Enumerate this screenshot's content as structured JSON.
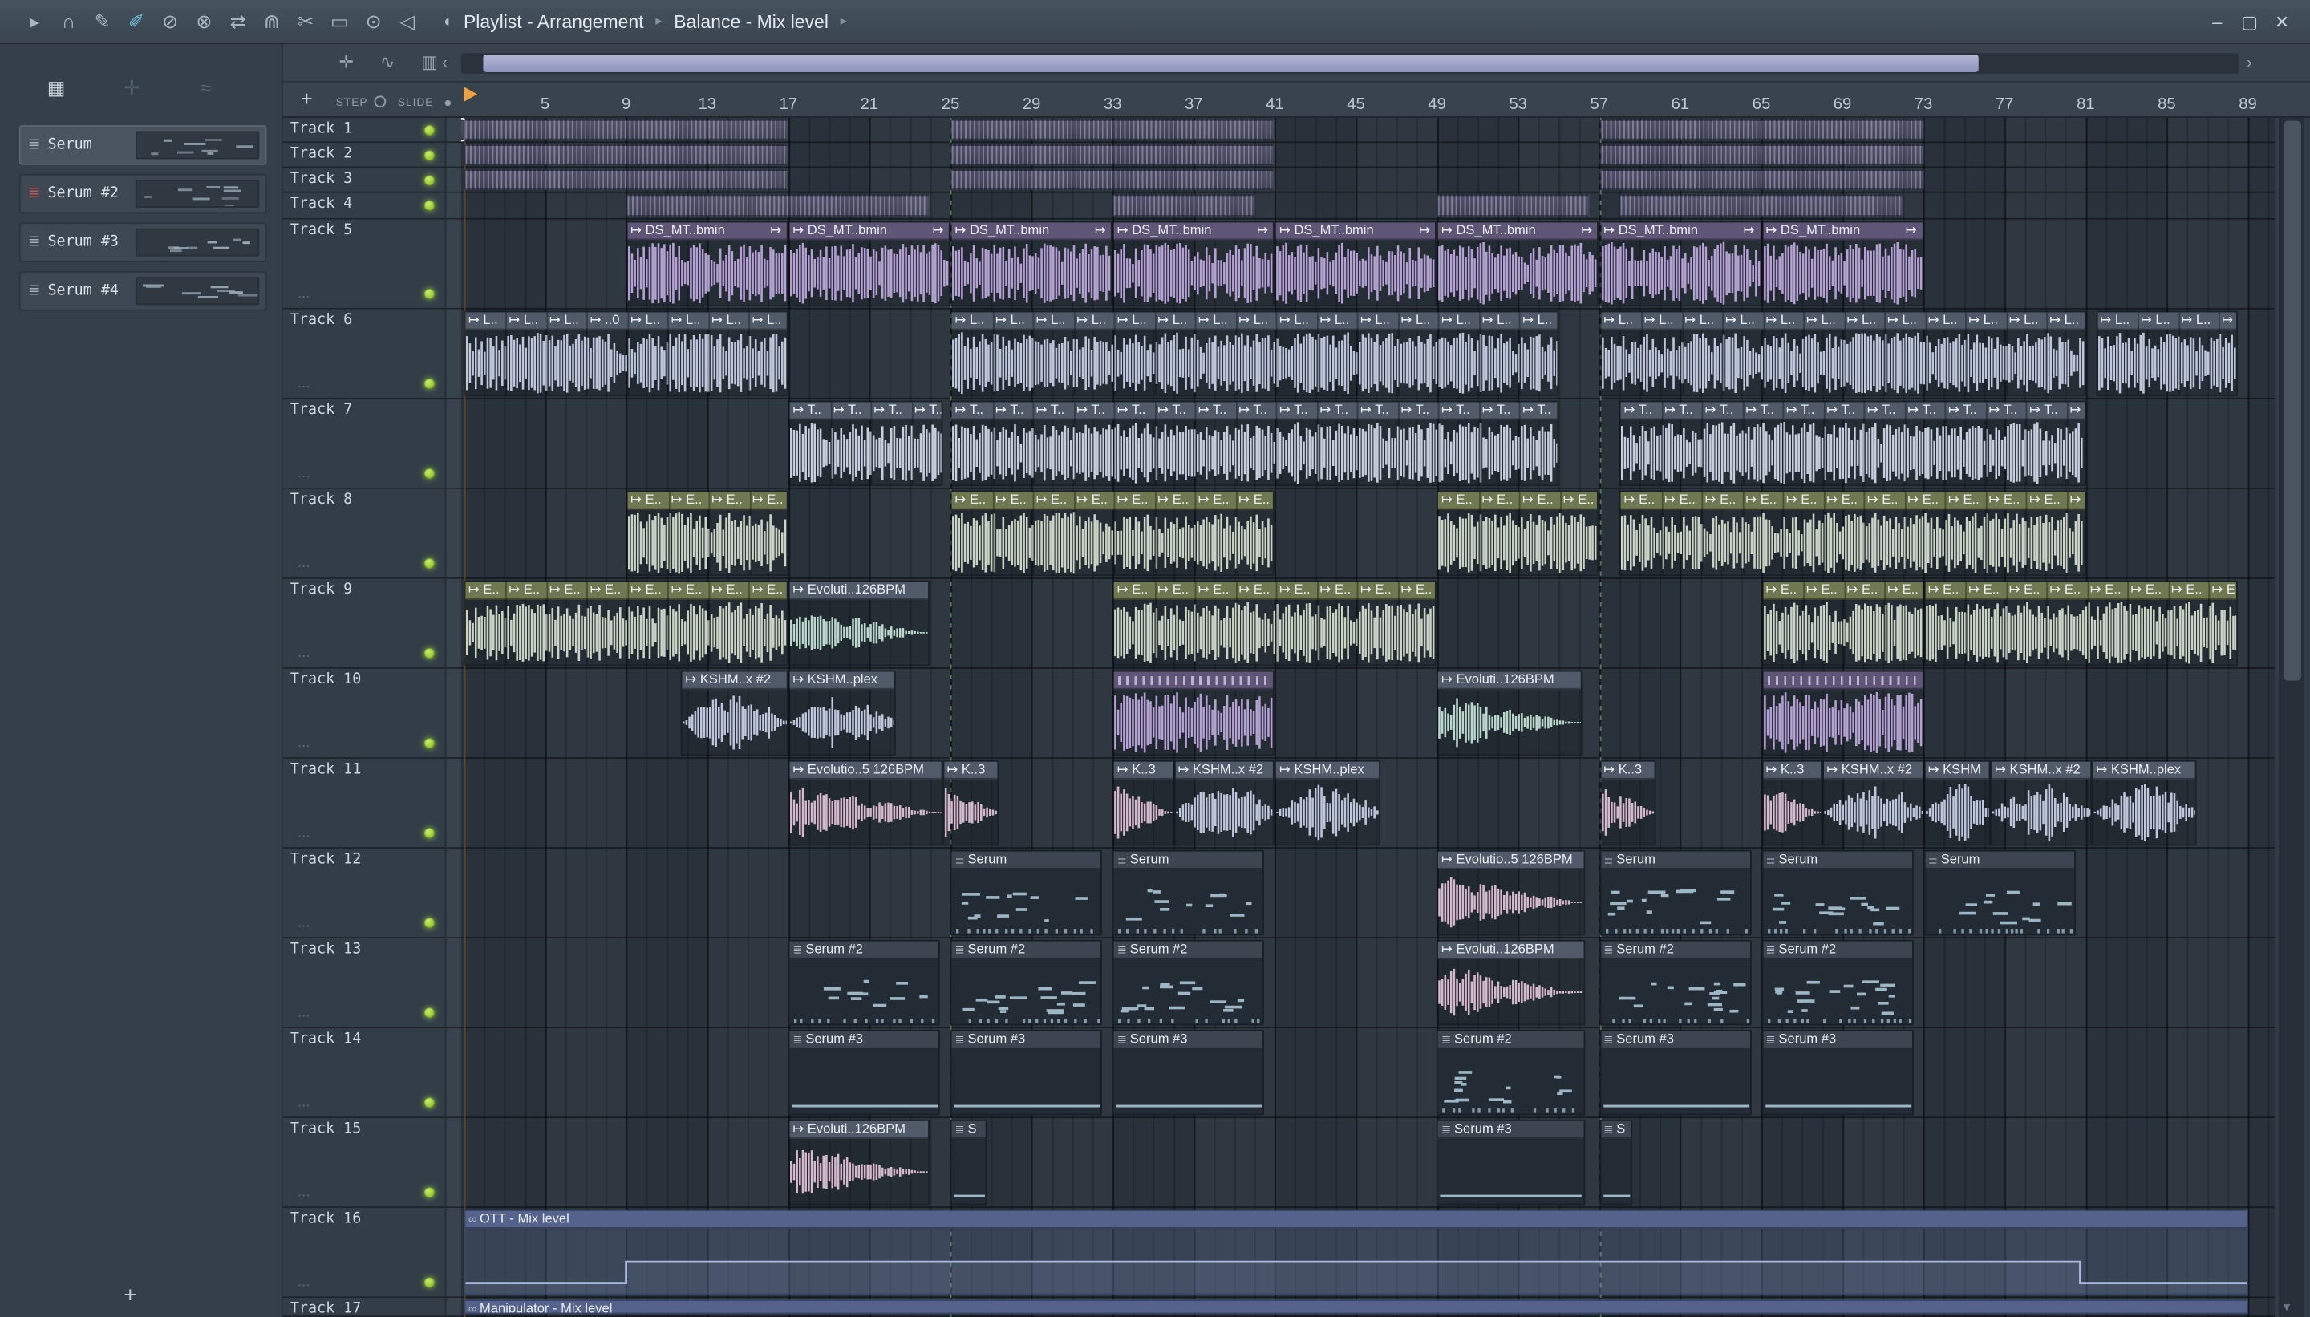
{
  "titlebar": {
    "icons": [
      {
        "name": "menu-arrow-icon",
        "glyph": "▸"
      },
      {
        "name": "headphones-icon",
        "glyph": "∩"
      },
      {
        "name": "draw-tool-icon",
        "glyph": "✎"
      },
      {
        "name": "paint-tool-icon",
        "glyph": "✐",
        "active": true
      },
      {
        "name": "delete-tool-icon",
        "glyph": "⊘"
      },
      {
        "name": "mute-tool-icon",
        "glyph": "⊗"
      },
      {
        "name": "slip-tool-icon",
        "glyph": "⇄"
      },
      {
        "name": "magnet-icon",
        "glyph": "⋒"
      },
      {
        "name": "slice-tool-icon",
        "glyph": "✂"
      },
      {
        "name": "select-tool-icon",
        "glyph": "▭"
      },
      {
        "name": "zoom-tool-icon",
        "glyph": "⊙"
      },
      {
        "name": "preview-tool-icon",
        "glyph": "◁"
      }
    ],
    "panel_icon": "◖",
    "breadcrumb": [
      "Playlist - Arrangement",
      "Balance - Mix level"
    ],
    "separator": "▸",
    "window_controls": {
      "minimize": "–",
      "maximize": "▢",
      "close": "✕"
    }
  },
  "sidebar": {
    "toolbar_icons": [
      {
        "name": "piano-roll-icon",
        "glyph": "▦",
        "dim": false
      },
      {
        "name": "pattern-dim-icon",
        "glyph": "✛",
        "dim": true
      },
      {
        "name": "wave-dim-icon",
        "glyph": "≈",
        "dim": true
      }
    ],
    "patterns": [
      {
        "name": "Serum",
        "selected": true,
        "icon_color": "#9fb0bc"
      },
      {
        "name": "Serum #2",
        "selected": false,
        "icon_color": "#c85050"
      },
      {
        "name": "Serum #3",
        "selected": false,
        "icon_color": "#9fb0bc"
      },
      {
        "name": "Serum #4",
        "selected": false,
        "icon_color": "#9fb0bc"
      }
    ],
    "add_button": "+"
  },
  "playlist": {
    "toolbar_icons": [
      {
        "name": "pointer-tool-icon",
        "glyph": "✛"
      },
      {
        "name": "link-tool-icon",
        "glyph": "∿"
      },
      {
        "name": "view-options-icon",
        "glyph": "▥"
      }
    ],
    "scroll": {
      "left_arrow": "‹",
      "right_arrow": "›",
      "down_arrow": "▾"
    },
    "add_track_button": "+",
    "step_label": "STEP",
    "slide_label": "SLIDE",
    "timeline_numbers": [
      5,
      9,
      13,
      17,
      21,
      25,
      29,
      33,
      37,
      41,
      45,
      49,
      53,
      57,
      61,
      65,
      69,
      73,
      77,
      81,
      85,
      89
    ],
    "marker_bars": [
      25,
      57
    ],
    "tracks": [
      "Track 1",
      "Track 2",
      "Track 3",
      "Track 4",
      "Track 5",
      "Track 6",
      "Track 7",
      "Track 8",
      "Track 9",
      "Track 10",
      "Track 11",
      "Track 12",
      "Track 13",
      "Track 14",
      "Track 15",
      "Track 16",
      "Track 17"
    ],
    "clips": [
      {
        "t": 1,
        "b0": 0.22,
        "b1": 1,
        "k": "stripes",
        "sel": true
      },
      {
        "t": 1,
        "b0": 1,
        "b1": 17,
        "k": "stripes"
      },
      {
        "t": 1,
        "b0": 25,
        "b1": 41,
        "k": "stripes"
      },
      {
        "t": 1,
        "b0": 57,
        "b1": 73,
        "k": "stripes"
      },
      {
        "t": 2,
        "b0": 1,
        "b1": 17,
        "k": "stripes"
      },
      {
        "t": 2,
        "b0": 25,
        "b1": 41,
        "k": "stripes"
      },
      {
        "t": 2,
        "b0": 57,
        "b1": 73,
        "k": "stripes"
      },
      {
        "t": 3,
        "b0": 1,
        "b1": 17,
        "k": "stripes"
      },
      {
        "t": 3,
        "b0": 25,
        "b1": 41,
        "k": "stripes"
      },
      {
        "t": 3,
        "b0": 57,
        "b1": 73,
        "k": "stripes"
      },
      {
        "t": 4,
        "b0": 9,
        "b1": 24,
        "k": "stripes"
      },
      {
        "t": 4,
        "b0": 33,
        "b1": 40,
        "k": "stripes"
      },
      {
        "t": 4,
        "b0": 49,
        "b1": 56.5,
        "k": "stripes"
      },
      {
        "t": 4,
        "b0": 58,
        "b1": 72,
        "k": "stripes"
      },
      {
        "t": 5,
        "b0": 9,
        "b1": 17,
        "k": "wave",
        "pal": "purple",
        "env": "flat",
        "labels": [
          {
            "o": 0,
            "x": "↦ DS_MT..bmin"
          },
          {
            "o": 6.9,
            "x": "↦"
          }
        ]
      },
      {
        "t": 5,
        "b0": 17,
        "b1": 25,
        "k": "wave",
        "pal": "purple",
        "env": "flat",
        "labels": [
          {
            "o": 0,
            "x": "↦ DS_MT..bmin"
          },
          {
            "o": 6.9,
            "x": "↦"
          }
        ]
      },
      {
        "t": 5,
        "b0": 25,
        "b1": 33,
        "k": "wave",
        "pal": "purple",
        "env": "flat",
        "labels": [
          {
            "o": 0,
            "x": "↦ DS_MT..bmin"
          },
          {
            "o": 6.9,
            "x": "↦"
          }
        ]
      },
      {
        "t": 5,
        "b0": 33,
        "b1": 41,
        "k": "wave",
        "pal": "purple",
        "env": "flat",
        "labels": [
          {
            "o": 0,
            "x": "↦ DS_MT..bmin"
          },
          {
            "o": 6.9,
            "x": "↦"
          }
        ]
      },
      {
        "t": 5,
        "b0": 41,
        "b1": 49,
        "k": "wave",
        "pal": "purple",
        "env": "flat",
        "labels": [
          {
            "o": 0,
            "x": "↦ DS_MT..bmin"
          },
          {
            "o": 6.9,
            "x": "↦"
          }
        ]
      },
      {
        "t": 5,
        "b0": 49,
        "b1": 57,
        "k": "wave",
        "pal": "purple",
        "env": "flat",
        "labels": [
          {
            "o": 0,
            "x": "↦ DS_MT..bmin"
          },
          {
            "o": 6.9,
            "x": "↦"
          }
        ]
      },
      {
        "t": 5,
        "b0": 57,
        "b1": 65,
        "k": "wave",
        "pal": "purple",
        "env": "flat",
        "labels": [
          {
            "o": 0,
            "x": "↦ DS_MT..bmin"
          },
          {
            "o": 6.9,
            "x": "↦"
          }
        ]
      },
      {
        "t": 5,
        "b0": 65,
        "b1": 73,
        "k": "wave",
        "pal": "purple",
        "env": "flat",
        "labels": [
          {
            "o": 0,
            "x": "↦ DS_MT..bmin"
          },
          {
            "o": 6.9,
            "x": "↦"
          }
        ]
      },
      {
        "t": 6,
        "b0": 1,
        "b1": 17,
        "k": "wave",
        "pal": "lav",
        "env": "flat",
        "reps": {
          "every": 2,
          "texts": [
            "↦ L..",
            "↦ L..",
            "↦ L..",
            "↦ ..0",
            "↦ L..",
            "↦ L..",
            "↦ L..",
            "↦ L.."
          ]
        }
      },
      {
        "t": 6,
        "b0": 25,
        "b1": 55,
        "k": "wave",
        "pal": "lav",
        "env": "flat",
        "rep": {
          "every": 2,
          "x": "↦ L.."
        }
      },
      {
        "t": 6,
        "b0": 57,
        "b1": 81,
        "k": "wave",
        "pal": "lav",
        "env": "flat",
        "rep": {
          "every": 2,
          "x": "↦ L.."
        }
      },
      {
        "t": 6,
        "b0": 81.5,
        "b1": 88.5,
        "k": "wave",
        "pal": "lav",
        "env": "flat",
        "rep": {
          "every": 2,
          "x": "↦ L.."
        }
      },
      {
        "t": 7,
        "b0": 17,
        "b1": 24.6,
        "k": "wave",
        "pal": "pale",
        "env": "flat",
        "rep": {
          "every": 2,
          "x": "↦ T.."
        }
      },
      {
        "t": 7,
        "b0": 25,
        "b1": 55,
        "k": "wave",
        "pal": "pale",
        "env": "flat",
        "rep": {
          "every": 2,
          "x": "↦ T.."
        }
      },
      {
        "t": 7,
        "b0": 58,
        "b1": 81,
        "k": "wave",
        "pal": "pale",
        "env": "flat",
        "rep": {
          "every": 2,
          "x": "↦ T.."
        }
      },
      {
        "t": 8,
        "b0": 9,
        "b1": 17,
        "k": "wave",
        "pal": "olive",
        "env": "flat",
        "rep": {
          "every": 2,
          "x": "↦ E.."
        }
      },
      {
        "t": 8,
        "b0": 25,
        "b1": 41,
        "k": "wave",
        "pal": "olive",
        "env": "flat",
        "rep": {
          "every": 2,
          "x": "↦ E.."
        }
      },
      {
        "t": 8,
        "b0": 49,
        "b1": 57,
        "k": "wave",
        "pal": "olive",
        "env": "flat",
        "rep": {
          "every": 2,
          "x": "↦ E.."
        }
      },
      {
        "t": 8,
        "b0": 58,
        "b1": 81,
        "k": "wave",
        "pal": "olive",
        "env": "flat",
        "rep": {
          "every": 2,
          "x": "↦ E.."
        }
      },
      {
        "t": 9,
        "b0": 1,
        "b1": 17,
        "k": "wave",
        "pal": "olive",
        "env": "flat",
        "rep": {
          "every": 2,
          "x": "↦ E.."
        }
      },
      {
        "t": 9,
        "b0": 17,
        "b1": 24,
        "k": "wave",
        "pal": "mint",
        "env": "decay",
        "label": "↦ Evoluti..126BPM"
      },
      {
        "t": 9,
        "b0": 33,
        "b1": 49,
        "k": "wave",
        "pal": "olive",
        "env": "flat",
        "rep": {
          "every": 2,
          "x": "↦ E.."
        }
      },
      {
        "t": 9,
        "b0": 65,
        "b1": 73,
        "k": "wave",
        "pal": "olive",
        "env": "flat",
        "rep": {
          "every": 2,
          "x": "↦ E.."
        }
      },
      {
        "t": 9,
        "b0": 73,
        "b1": 88.5,
        "k": "wave",
        "pal": "olive",
        "env": "flat",
        "rep": {
          "every": 2,
          "x": "↦ E.."
        }
      },
      {
        "t": 10,
        "b0": 11.7,
        "b1": 17,
        "k": "wave",
        "pal": "lav",
        "env": "swell",
        "label": "↦ KSHM..x #2"
      },
      {
        "t": 10,
        "b0": 17,
        "b1": 22.3,
        "k": "wave",
        "pal": "lav",
        "env": "swell",
        "label": "↦ KSHM..plex"
      },
      {
        "t": 10,
        "b0": 33,
        "b1": 41,
        "k": "wave",
        "pal": "purple",
        "env": "flat",
        "ticks": true
      },
      {
        "t": 10,
        "b0": 49,
        "b1": 56.2,
        "k": "wave",
        "pal": "mint",
        "env": "decay",
        "label": "↦ Evoluti..126BPM"
      },
      {
        "t": 10,
        "b0": 65,
        "b1": 73,
        "k": "wave",
        "pal": "purple",
        "env": "flat",
        "ticks": true
      },
      {
        "t": 11,
        "b0": 17,
        "b1": 24.6,
        "k": "wave",
        "pal": "pink",
        "env": "decay",
        "label": "↦ Evolutio..5 126BPM"
      },
      {
        "t": 11,
        "b0": 24.6,
        "b1": 27.4,
        "k": "wave",
        "pal": "pink",
        "env": "decay",
        "label": "↦ K..3"
      },
      {
        "t": 11,
        "b0": 33,
        "b1": 36,
        "k": "wave",
        "pal": "pink",
        "env": "decay",
        "label": "↦ K..3"
      },
      {
        "t": 11,
        "b0": 36,
        "b1": 41,
        "k": "wave",
        "pal": "lav",
        "env": "swell",
        "label": "↦ KSHM..x #2"
      },
      {
        "t": 11,
        "b0": 41,
        "b1": 46.2,
        "k": "wave",
        "pal": "lav",
        "env": "swell",
        "label": "↦ KSHM..plex"
      },
      {
        "t": 11,
        "b0": 57,
        "b1": 59.8,
        "k": "wave",
        "pal": "pink",
        "env": "decay",
        "label": "↦ K..3"
      },
      {
        "t": 11,
        "b0": 65,
        "b1": 68,
        "k": "wave",
        "pal": "pink",
        "env": "decay",
        "label": "↦ K..3"
      },
      {
        "t": 11,
        "b0": 68,
        "b1": 73,
        "k": "wave",
        "pal": "lav",
        "env": "swell",
        "label": "↦ KSHM..x #2"
      },
      {
        "t": 11,
        "b0": 73,
        "b1": 76.3,
        "k": "wave",
        "pal": "lav",
        "env": "swell",
        "label": "↦ KSHM"
      },
      {
        "t": 11,
        "b0": 76.3,
        "b1": 81.3,
        "k": "wave",
        "pal": "lav",
        "env": "swell",
        "label": "↦ KSHM..x #2"
      },
      {
        "t": 11,
        "b0": 81.3,
        "b1": 86.5,
        "k": "wave",
        "pal": "lav",
        "env": "swell",
        "label": "↦ KSHM..plex"
      },
      {
        "t": 12,
        "b0": 25,
        "b1": 32.5,
        "k": "midi",
        "label": "Serum"
      },
      {
        "t": 12,
        "b0": 33,
        "b1": 40.5,
        "k": "midi",
        "label": "Serum"
      },
      {
        "t": 12,
        "b0": 49,
        "b1": 56.3,
        "k": "wave",
        "pal": "pink",
        "env": "decay",
        "label": "↦ Evolutio..5 126BPM"
      },
      {
        "t": 12,
        "b0": 57,
        "b1": 64.5,
        "k": "midi",
        "label": "Serum"
      },
      {
        "t": 12,
        "b0": 65,
        "b1": 72.5,
        "k": "midi",
        "label": "Serum"
      },
      {
        "t": 12,
        "b0": 73,
        "b1": 80.5,
        "k": "midi",
        "label": "Serum"
      },
      {
        "t": 13,
        "b0": 17,
        "b1": 24.5,
        "k": "midi",
        "label": "Serum #2"
      },
      {
        "t": 13,
        "b0": 25,
        "b1": 32.5,
        "k": "midi",
        "label": "Serum #2"
      },
      {
        "t": 13,
        "b0": 33,
        "b1": 40.5,
        "k": "midi",
        "label": "Serum #2"
      },
      {
        "t": 13,
        "b0": 49,
        "b1": 56.3,
        "k": "wave",
        "pal": "pink",
        "env": "decay",
        "label": "↦ Evoluti..126BPM"
      },
      {
        "t": 13,
        "b0": 57,
        "b1": 64.5,
        "k": "midi",
        "label": "Serum #2"
      },
      {
        "t": 13,
        "b0": 65,
        "b1": 72.5,
        "k": "midi",
        "label": "Serum #2"
      },
      {
        "t": 14,
        "b0": 17,
        "b1": 24.5,
        "k": "midiline",
        "label": "Serum #3"
      },
      {
        "t": 14,
        "b0": 25,
        "b1": 32.5,
        "k": "midiline",
        "label": "Serum #3"
      },
      {
        "t": 14,
        "b0": 33,
        "b1": 40.5,
        "k": "midiline",
        "label": "Serum #3"
      },
      {
        "t": 14,
        "b0": 49,
        "b1": 56.3,
        "k": "midi",
        "label": "Serum #2"
      },
      {
        "t": 14,
        "b0": 57,
        "b1": 64.5,
        "k": "midiline",
        "label": "Serum #3"
      },
      {
        "t": 14,
        "b0": 65,
        "b1": 72.5,
        "k": "midiline",
        "label": "Serum #3"
      },
      {
        "t": 15,
        "b0": 17,
        "b1": 24,
        "k": "wave",
        "pal": "pink",
        "env": "decay",
        "label": "↦ Evoluti..126BPM"
      },
      {
        "t": 15,
        "b0": 25,
        "b1": 26.8,
        "k": "midiline",
        "label": "S"
      },
      {
        "t": 15,
        "b0": 49,
        "b1": 56.3,
        "k": "midiline",
        "label": "Serum #3"
      },
      {
        "t": 15,
        "b0": 57,
        "b1": 58.6,
        "k": "midiline",
        "label": "S"
      },
      {
        "t": 16,
        "b0": 1,
        "b1": 89,
        "k": "auto",
        "label": "OTT - Mix level",
        "pts": [
          [
            0,
            0.82
          ],
          [
            0.09,
            0.82
          ],
          [
            0.09,
            0.5
          ],
          [
            0.905,
            0.5
          ],
          [
            0.905,
            0.82
          ],
          [
            1,
            0.82
          ]
        ]
      },
      {
        "t": 17,
        "b0": 1,
        "b1": 89,
        "k": "autohead",
        "label": "Manipulator - Mix level"
      }
    ]
  },
  "colors": {
    "accent_green": "#9ccb35",
    "playhead_orange": "#eda13f",
    "marker_green": "#7fbf6f",
    "palettes": {
      "purple": {
        "h": "#5f5577",
        "w": "#c2abe2"
      },
      "lav": {
        "h": "#505a68",
        "w": "#ccd5ea"
      },
      "pale": {
        "h": "#505a68",
        "w": "#d6dceb"
      },
      "olive": {
        "h": "#6f7850",
        "w": "#dbe3d2"
      },
      "mint": {
        "h": "#505a68",
        "w": "#c8e7d8"
      },
      "pink": {
        "h": "#505a68",
        "w": "#e6c5db"
      },
      "midi": {
        "h": "#3d4650",
        "w": "#9db6c6"
      },
      "auto": {
        "h": "#55638c",
        "w": "#a9bce0"
      }
    }
  }
}
